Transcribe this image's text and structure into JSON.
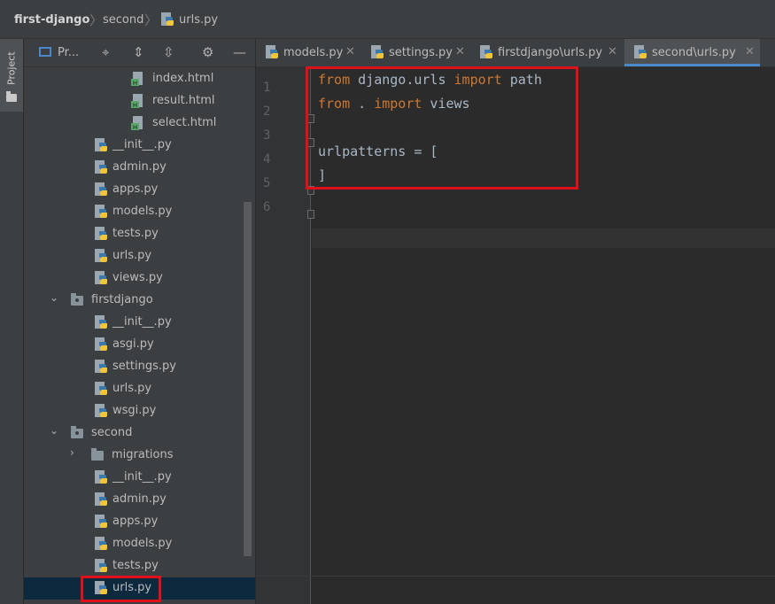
{
  "breadcrumb": {
    "project": "first-django",
    "folder": "second",
    "file": "urls.py"
  },
  "side_strip": {
    "label": "Project"
  },
  "project_panel": {
    "title": "Pr...",
    "tree": [
      {
        "label": "index.html",
        "kind": "html"
      },
      {
        "label": "result.html",
        "kind": "html"
      },
      {
        "label": "select.html",
        "kind": "html"
      },
      {
        "label": "__init__.py",
        "kind": "py"
      },
      {
        "label": "admin.py",
        "kind": "py"
      },
      {
        "label": "apps.py",
        "kind": "py"
      },
      {
        "label": "models.py",
        "kind": "py"
      },
      {
        "label": "tests.py",
        "kind": "py"
      },
      {
        "label": "urls.py",
        "kind": "py"
      },
      {
        "label": "views.py",
        "kind": "py"
      },
      {
        "label": "firstdjango",
        "kind": "folder",
        "expanded": true
      },
      {
        "label": "__init__.py",
        "kind": "py"
      },
      {
        "label": "asgi.py",
        "kind": "py"
      },
      {
        "label": "settings.py",
        "kind": "py"
      },
      {
        "label": "urls.py",
        "kind": "py"
      },
      {
        "label": "wsgi.py",
        "kind": "py"
      },
      {
        "label": "second",
        "kind": "folder",
        "expanded": true
      },
      {
        "label": "migrations",
        "kind": "folder",
        "expanded": false
      },
      {
        "label": "__init__.py",
        "kind": "py"
      },
      {
        "label": "admin.py",
        "kind": "py"
      },
      {
        "label": "apps.py",
        "kind": "py"
      },
      {
        "label": "models.py",
        "kind": "py"
      },
      {
        "label": "tests.py",
        "kind": "py"
      },
      {
        "label": "urls.py",
        "kind": "py",
        "selected": true
      }
    ]
  },
  "tabs": [
    {
      "label": "models.py"
    },
    {
      "label": "settings.py"
    },
    {
      "label": "firstdjango\\urls.py"
    },
    {
      "label": "second\\urls.py",
      "active": true
    }
  ],
  "editor": {
    "line_numbers": [
      "1",
      "2",
      "3",
      "4",
      "5",
      "6"
    ],
    "lines": [
      {
        "kw1": "from",
        "mid": " django.urls ",
        "kw2": "import",
        "tail": " path"
      },
      {
        "kw1": "from",
        "mid": " . ",
        "kw2": "import",
        "tail": " views"
      },
      {
        "kw1": "",
        "mid": "",
        "kw2": "",
        "tail": ""
      },
      {
        "kw1": "",
        "mid": "urlpatterns = [",
        "kw2": "",
        "tail": ""
      },
      {
        "kw1": "",
        "mid": "]",
        "kw2": "",
        "tail": ""
      },
      {
        "kw1": "",
        "mid": "",
        "kw2": "",
        "tail": ""
      }
    ]
  },
  "colors": {
    "highlight_border": "#e0101b",
    "selection_bg": "#0d293e",
    "active_tab_underline": "#4a88c7",
    "keyword": "#cc7832",
    "code_text": "#a9b7c6"
  }
}
